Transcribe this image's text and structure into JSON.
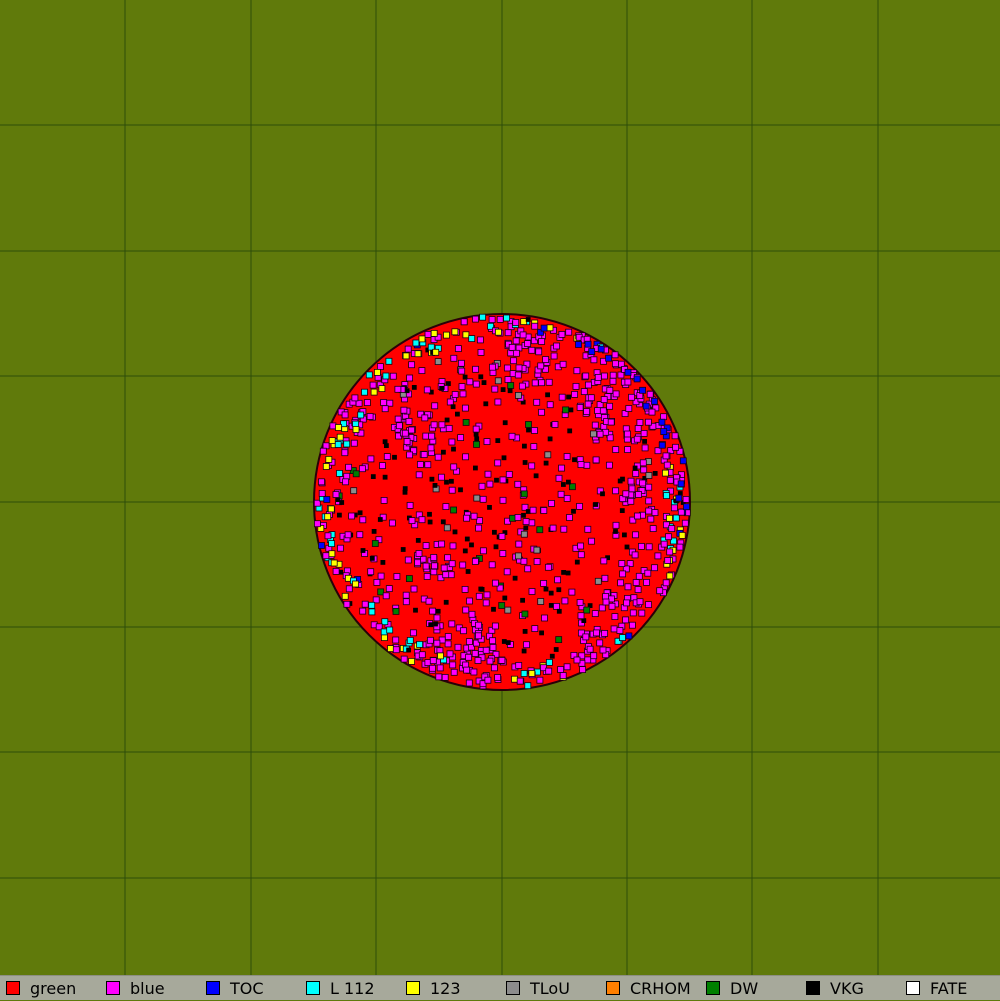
{
  "simulation": {
    "background_color": "#607a0b",
    "grid_line_color": "#2e4d0a",
    "cell_outline_color": "#3a1020",
    "colony_shape": "circle"
  },
  "legend": {
    "items": [
      {
        "label": "green",
        "color": "#ff0000"
      },
      {
        "label": "blue",
        "color": "#ff00ff"
      },
      {
        "label": "TOC",
        "color": "#0000ff"
      },
      {
        "label": "L 112",
        "color": "#00ffff"
      },
      {
        "label": "123",
        "color": "#ffff00"
      },
      {
        "label": "TLoU",
        "color": "#8c8c8c"
      },
      {
        "label": "CRHOM",
        "color": "#ff7f00"
      },
      {
        "label": "DW",
        "color": "#007f00"
      },
      {
        "label": "VKG",
        "color": "#000000"
      },
      {
        "label": "FATE",
        "color": "#ffffff"
      }
    ]
  }
}
